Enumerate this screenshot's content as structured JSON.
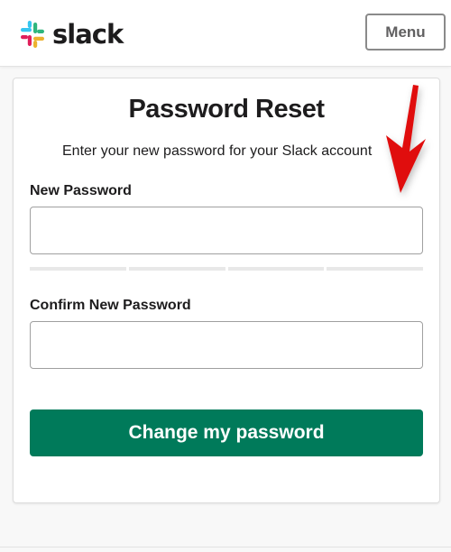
{
  "header": {
    "brand": "slack",
    "menu_label": "Menu",
    "logo_icon": "slack-hash-logo-icon",
    "brand_colors": [
      "#36C5F0",
      "#2EB67D",
      "#ECB22E",
      "#E01E5A"
    ]
  },
  "card": {
    "title": "Password Reset",
    "subtitle": "Enter your new password for your  Slack account",
    "new_password_label": "New Password",
    "new_password_value": "",
    "confirm_password_label": "Confirm New Password",
    "confirm_password_value": "",
    "submit_label": "Change my password",
    "strength_meter_segments": 4,
    "strength_meter_filled": 0
  },
  "annotation": {
    "icon": "red-arrow-icon",
    "color": "#e01010"
  },
  "colors": {
    "accent": "#007a5a",
    "text": "#1d1c1d"
  }
}
